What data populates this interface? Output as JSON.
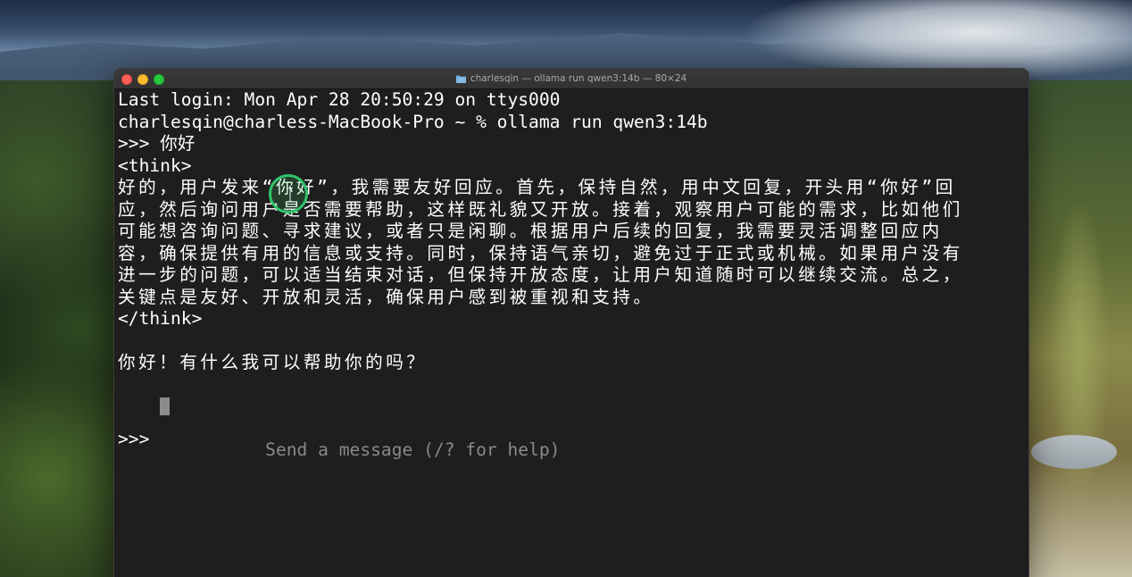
{
  "window": {
    "title": "charlesqin — ollama run qwen3:14b — 80×24",
    "folder_icon": "folder-icon",
    "controls": {
      "close_color": "#ff5f57",
      "minimize_color": "#febc2e",
      "maximize_color": "#28c840"
    }
  },
  "terminal": {
    "background": "#1e1e1e",
    "text_color": "#ffffff",
    "last_login": "Last login: Mon Apr 28 20:50:29 on ttys000",
    "shell_prompt": "charlesqin@charless-MacBook-Pro ~ % ollama run qwen3:14b",
    "user_message": ">>> 你好",
    "think_open": "<think>",
    "think_content": "好的，用户发来“你好”，我需要友好回应。首先，保持自然，用中文回复，开头用“你好”回应，然后询问用户是否需要帮助，这样既礼貌又开放。接着，观察用户可能的需求，比如他们可能想咨询问题、寻求建议，或者只是闲聊。根据用户后续的回复，我需要灵活调整回应内容，确保提供有用的信息或支持。同时，保持语气亲切，避免过于正式或机械。如果用户没有进一步的问题，可以适当结束对话，但保持开放态度，让用户知道随时可以继续交流。总之，关键点是友好、开放和灵活，确保用户感到被重视和支持。",
    "think_close": "</think>",
    "assistant_reply": "你好！有什么我可以帮助你的吗？",
    "input_prompt": ">>> ",
    "input_placeholder": "Send a message (/? for help)"
  }
}
